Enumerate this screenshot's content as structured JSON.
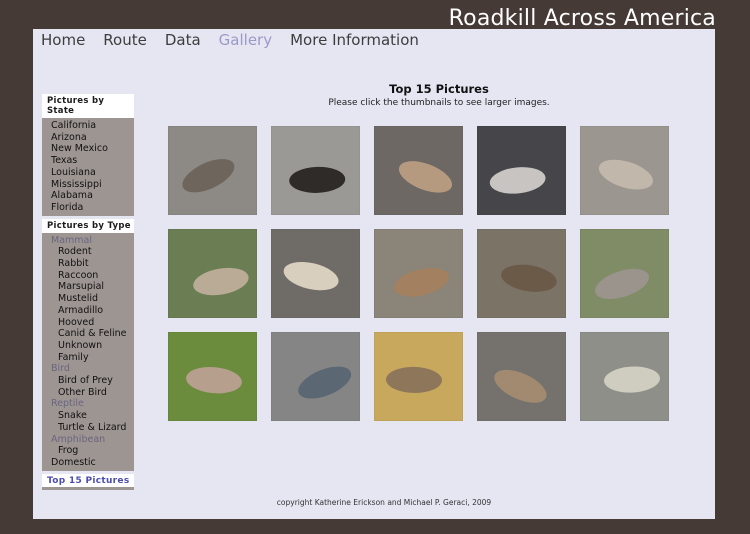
{
  "site": {
    "title": "Roadkill Across America"
  },
  "nav": [
    "Home",
    "Route",
    "Data",
    "Gallery",
    "More Information"
  ],
  "sidebar": {
    "by_state_heading": "Pictures by State",
    "states": [
      "California",
      "Arizona",
      "New Mexico",
      "Texas",
      "Louisiana",
      "Mississippi",
      "Alabama",
      "Florida"
    ],
    "by_type_heading": "Pictures by Type",
    "types": {
      "mammal": "Mammal",
      "rodent": "Rodent",
      "rabbit": "Rabbit",
      "raccoon": "Raccoon",
      "marsupial": "Marsupial",
      "mustelid": "Mustelid",
      "armadillo": "Armadillo",
      "hooved": "Hooved",
      "canid": "Canid & Feline",
      "unknown": "Unknown Family",
      "bird": "Bird",
      "bird_of_prey": "Bird of Prey",
      "other_bird": "Other Bird",
      "reptile": "Reptile",
      "snake": "Snake",
      "turtle": "Turtle & Lizard",
      "amphibean": "Amphibean",
      "frog": "Frog",
      "domestic": "Domestic"
    },
    "top15": "Top 15 Pictures"
  },
  "main": {
    "title": "Top 15 Pictures",
    "subtitle": "Please click the thumbnails to see larger images."
  },
  "thumbnails": [
    {
      "bg": "#8d8a86",
      "fg": "#6e655d"
    },
    {
      "bg": "#9a9995",
      "fg": "#2e2b28"
    },
    {
      "bg": "#6d6863",
      "fg": "#b59a80"
    },
    {
      "bg": "#46464a",
      "fg": "#c8c4c2"
    },
    {
      "bg": "#9b9690",
      "fg": "#c2b7ab"
    },
    {
      "bg": "#6b7d53",
      "fg": "#b9ab96"
    },
    {
      "bg": "#6f6c68",
      "fg": "#d8cfbe"
    },
    {
      "bg": "#8a8479",
      "fg": "#a3805f"
    },
    {
      "bg": "#7a7366",
      "fg": "#6b5a48"
    },
    {
      "bg": "#7f8c65",
      "fg": "#9b948c"
    },
    {
      "bg": "#6b8b3d",
      "fg": "#b6a08d"
    },
    {
      "bg": "#858585",
      "fg": "#5b6772"
    },
    {
      "bg": "#c8a85c",
      "fg": "#8e765a"
    },
    {
      "bg": "#75726e",
      "fg": "#a18a70"
    },
    {
      "bg": "#8e8f88",
      "fg": "#cfcdbf"
    }
  ],
  "footer": "copyright Katherine Erickson and Michael P. Geraci, 2009"
}
